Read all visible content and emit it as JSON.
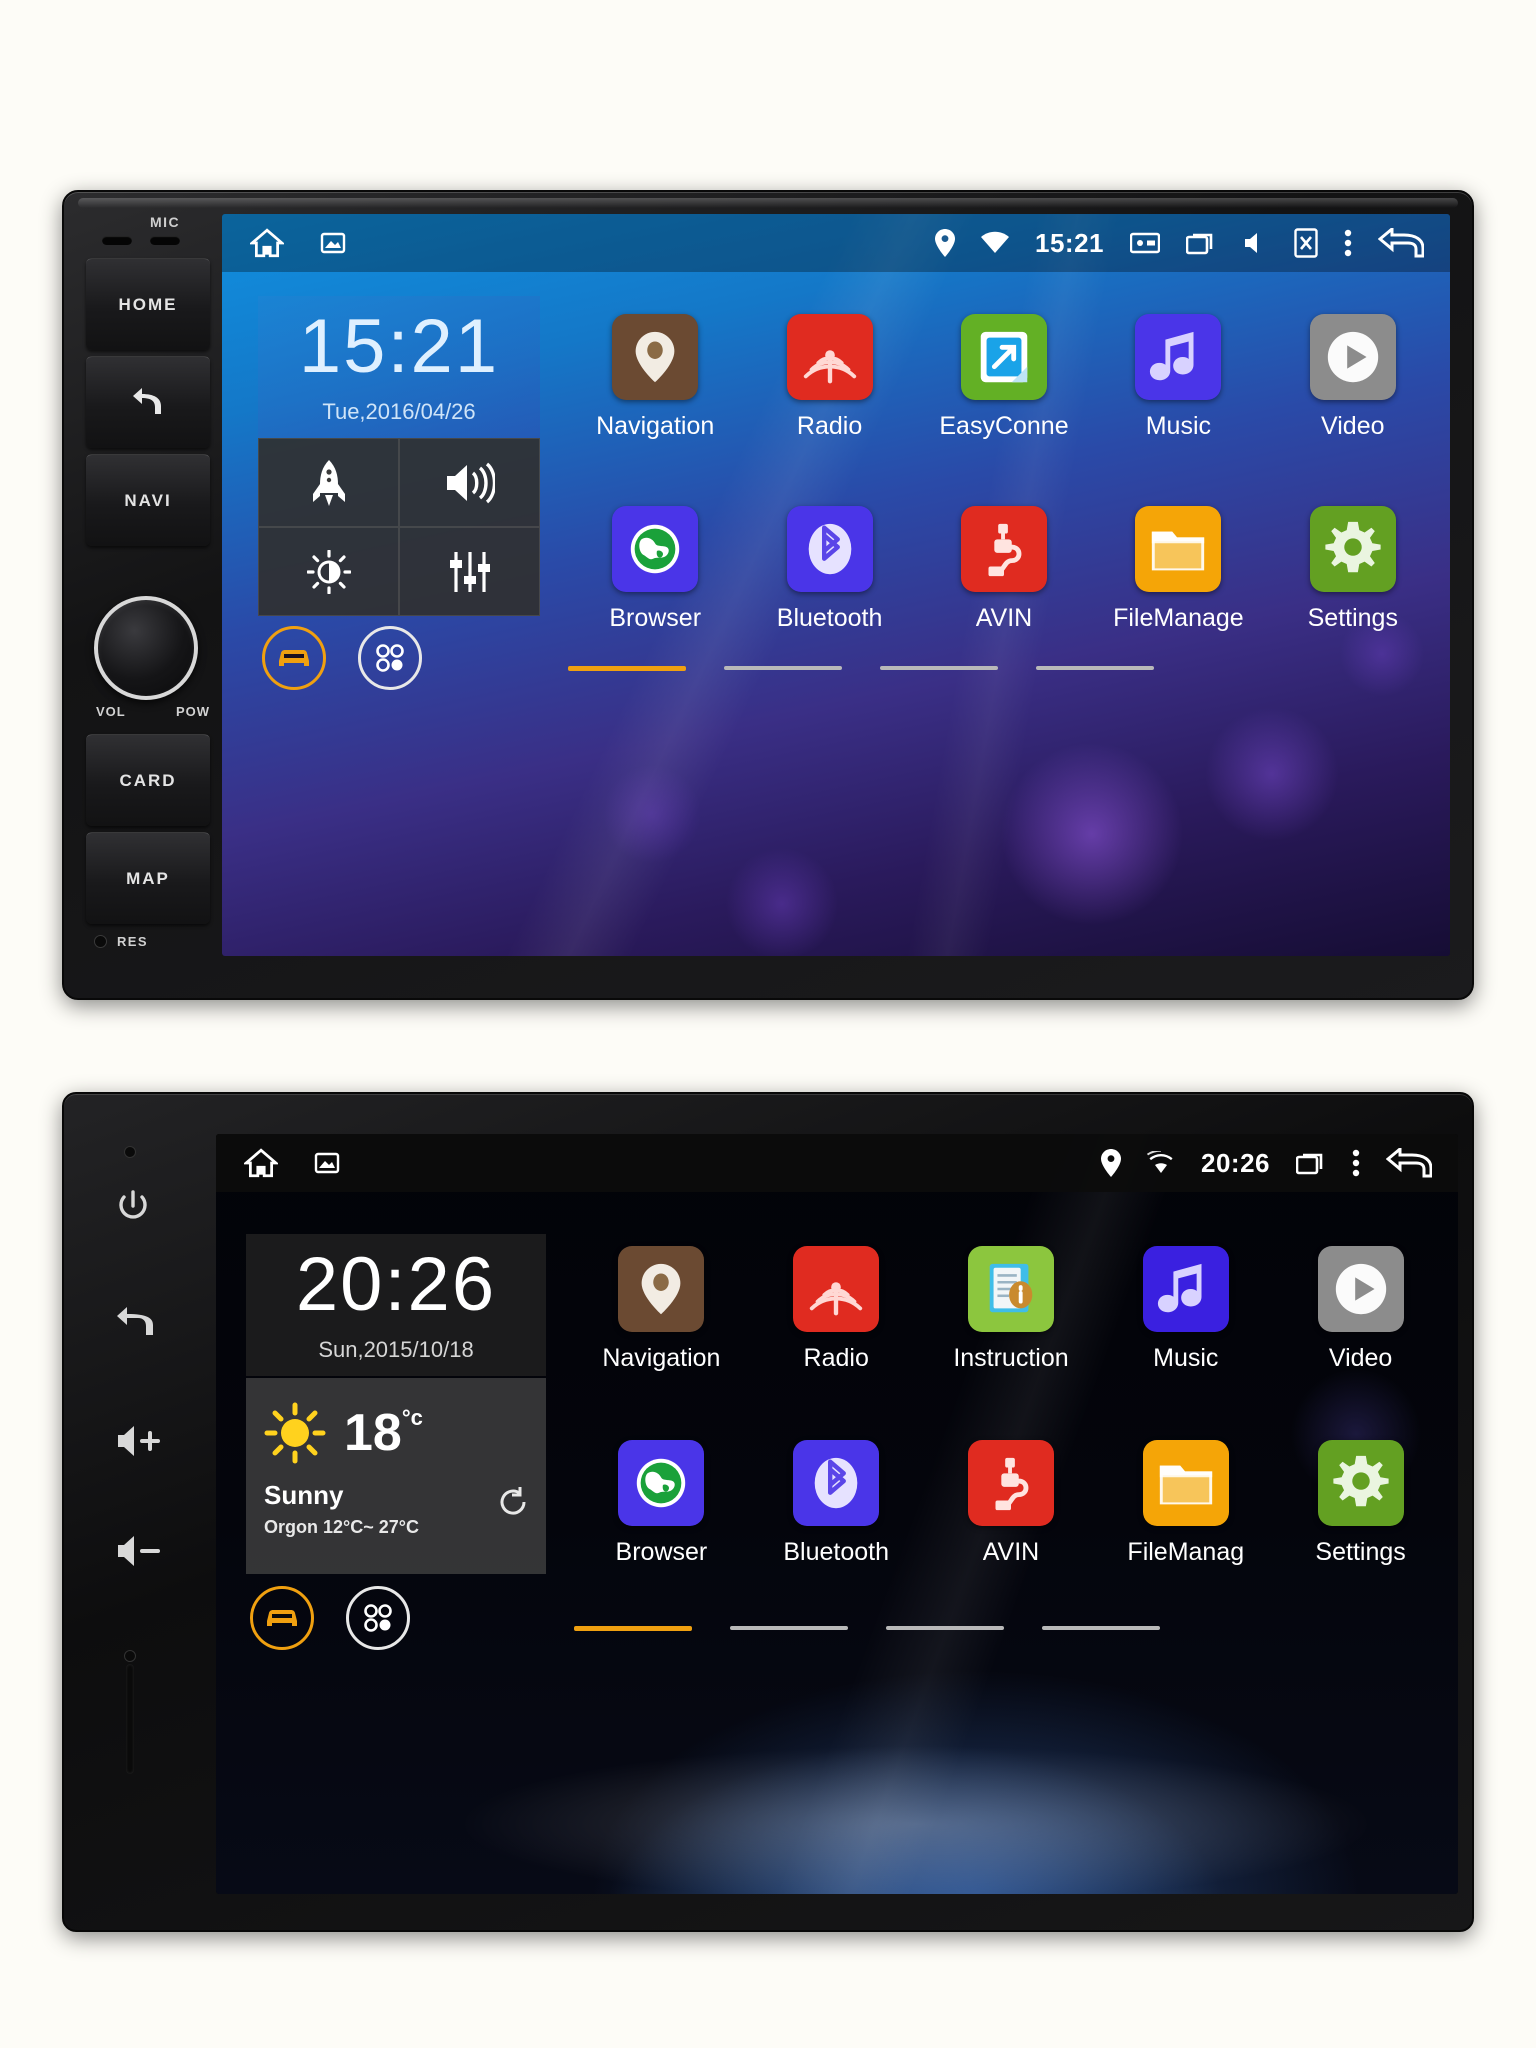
{
  "device1": {
    "hardware": {
      "mic_label": "MIC",
      "buttons": [
        "HOME",
        "back-arrow",
        "NAVI"
      ],
      "home_label": "HOME",
      "navi_label": "NAVI",
      "knob_left_label": "VOL",
      "knob_right_label": "POW",
      "card_label": "CARD",
      "map_label": "MAP",
      "res_label": "RES"
    },
    "statusbar": {
      "home_icon": "home-icon",
      "screenshot_icon": "screenshot-icon",
      "gps_icon": "gps-pin-icon",
      "wifi_icon": "wifi-icon",
      "time": "15:21",
      "icons_right": [
        "sd-card-icon",
        "recents-icon",
        "mute-icon",
        "screen-off-icon",
        "overflow-menu-icon",
        "back-icon"
      ]
    },
    "clock_widget": {
      "time": "15:21",
      "date": "Tue,2016/04/26"
    },
    "tiles": [
      {
        "name": "rocket-icon",
        "label": "Launcher"
      },
      {
        "name": "volume-icon",
        "label": "Volume"
      },
      {
        "name": "brightness-icon",
        "label": "Brightness"
      },
      {
        "name": "equalizer-icon",
        "label": "Equalizer"
      }
    ],
    "apps_row1": [
      {
        "label": "Navigation",
        "icon": "map-pin-icon",
        "color": "#6b4a32"
      },
      {
        "label": "Radio",
        "icon": "radio-wave-icon",
        "color": "#e02b20"
      },
      {
        "label": "EasyConne",
        "icon": "easyconnect-icon",
        "color": "#63b025"
      },
      {
        "label": "Music",
        "icon": "music-note-icon",
        "color": "#4a35e8"
      },
      {
        "label": "Video",
        "icon": "play-circle-icon",
        "color": "#8c8c8c"
      }
    ],
    "apps_row2": [
      {
        "label": "Browser",
        "icon": "globe-icon",
        "color": "#4a35e8"
      },
      {
        "label": "Bluetooth",
        "icon": "bluetooth-icon",
        "color": "#4a35e8"
      },
      {
        "label": "AVIN",
        "icon": "avin-plug-icon",
        "color": "#e02b20"
      },
      {
        "label": "FileManage",
        "icon": "folder-icon",
        "color": "#f5a507"
      },
      {
        "label": "Settings",
        "icon": "gear-icon",
        "color": "#63a022"
      }
    ],
    "dock": [
      {
        "name": "car-icon",
        "label": "Car Mode"
      },
      {
        "name": "app-drawer-icon",
        "label": "All Apps"
      }
    ],
    "pager": {
      "total": 4,
      "active": 1
    }
  },
  "device2": {
    "hardware": {
      "power_label": "power-icon",
      "back_label": "back-icon",
      "vol_up_label": "◁+",
      "vol_down_label": "◁-",
      "vol_up_text": "+",
      "vol_down_text": "−"
    },
    "statusbar": {
      "time": "20:26",
      "icons_right": [
        "gps-pin-icon",
        "wifi-icon",
        "recents-icon",
        "overflow-menu-icon",
        "back-icon"
      ]
    },
    "clock_widget": {
      "time": "20:26",
      "date": "Sun,2015/10/18"
    },
    "weather_widget": {
      "icon": "sun-icon",
      "temperature": "18",
      "unit": "°c",
      "condition": "Sunny",
      "range": "Orgon 12°C~ 27°C",
      "refresh_icon": "refresh-icon"
    },
    "apps_row1": [
      {
        "label": "Navigation",
        "icon": "map-pin-icon",
        "color": "#6b4a32"
      },
      {
        "label": "Radio",
        "icon": "radio-wave-icon",
        "color": "#e02b20"
      },
      {
        "label": "Instruction",
        "icon": "document-info-icon",
        "color": "#8cc63e"
      },
      {
        "label": "Music",
        "icon": "music-note-icon",
        "color": "#3a20e0"
      },
      {
        "label": "Video",
        "icon": "play-circle-icon",
        "color": "#8c8c8c"
      }
    ],
    "apps_row2": [
      {
        "label": "Browser",
        "icon": "globe-icon",
        "color": "#4a35e8"
      },
      {
        "label": "Bluetooth",
        "icon": "bluetooth-icon",
        "color": "#4a35e8"
      },
      {
        "label": "AVIN",
        "icon": "avin-plug-icon",
        "color": "#e02b20"
      },
      {
        "label": "FileManag",
        "icon": "folder-icon",
        "color": "#f5a507"
      },
      {
        "label": "Settings",
        "icon": "gear-icon",
        "color": "#63a022"
      }
    ],
    "dock": [
      {
        "name": "car-icon",
        "label": "Car Mode"
      },
      {
        "name": "app-drawer-icon",
        "label": "All Apps"
      }
    ],
    "pager": {
      "total": 4,
      "active": 1
    }
  },
  "colors": {
    "accent_orange": "#f0a010",
    "brand_blue": "#1090e0",
    "status_white": "#ffffff"
  }
}
